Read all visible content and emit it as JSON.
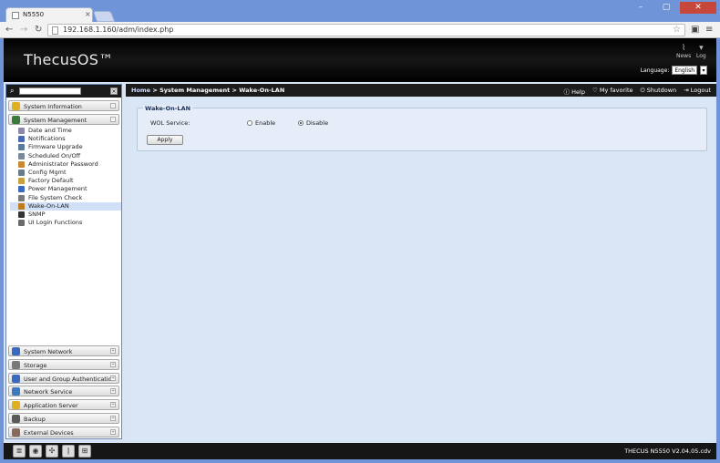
{
  "browser": {
    "tab_title": "N5550",
    "url": "192.168.1.160/adm/index.php"
  },
  "header": {
    "logo": "ThecusOS™",
    "news_label": "News",
    "log_label": "Log",
    "language_label": "Language:",
    "language_value": "English"
  },
  "breadcrumb": {
    "home": "Home",
    "path": "> System Management > Wake-On-LAN"
  },
  "tools": {
    "help": "Help",
    "favorite": "My favorite",
    "shutdown": "Shutdown",
    "logout": "Logout"
  },
  "sidebar": {
    "categories_top": [
      {
        "label": "System Information",
        "color": "#e0b020"
      },
      {
        "label": "System Management",
        "color": "#3b7a3b"
      }
    ],
    "sub_items": [
      {
        "label": "Date and Time",
        "color": "#8a8aa8"
      },
      {
        "label": "Notifications",
        "color": "#4a6ab0"
      },
      {
        "label": "Firmware Upgrade",
        "color": "#5a7a9a"
      },
      {
        "label": "Scheduled On/Off",
        "color": "#7a8a9a"
      },
      {
        "label": "Administrator Password",
        "color": "#c88a30"
      },
      {
        "label": "Config Mgmt",
        "color": "#6a7a8a"
      },
      {
        "label": "Factory Default",
        "color": "#c8a040"
      },
      {
        "label": "Power Management",
        "color": "#3a6ac0"
      },
      {
        "label": "File System Check",
        "color": "#7a7a7a"
      },
      {
        "label": "Wake-On-LAN",
        "color": "#c07a20"
      },
      {
        "label": "SNMP",
        "color": "#333333"
      },
      {
        "label": "UI Login Functions",
        "color": "#6a6a6a"
      }
    ],
    "categories_bottom": [
      {
        "label": "System Network",
        "color": "#3a6ac0"
      },
      {
        "label": "Storage",
        "color": "#7a7a7a"
      },
      {
        "label": "User and Group Authentication",
        "color": "#3a6ac0"
      },
      {
        "label": "Network Service",
        "color": "#3a7ac0"
      },
      {
        "label": "Application Server",
        "color": "#e0b020"
      },
      {
        "label": "Backup",
        "color": "#5a5a5a"
      },
      {
        "label": "External Devices",
        "color": "#8a6a5a"
      }
    ]
  },
  "panel": {
    "title": "Wake-On-LAN",
    "wol_label": "WOL Service:",
    "enable_label": "Enable",
    "disable_label": "Disable",
    "selected": "Disable",
    "apply_label": "Apply"
  },
  "footer": {
    "version": "THECUS N5550 V2.04.05.cdv"
  }
}
